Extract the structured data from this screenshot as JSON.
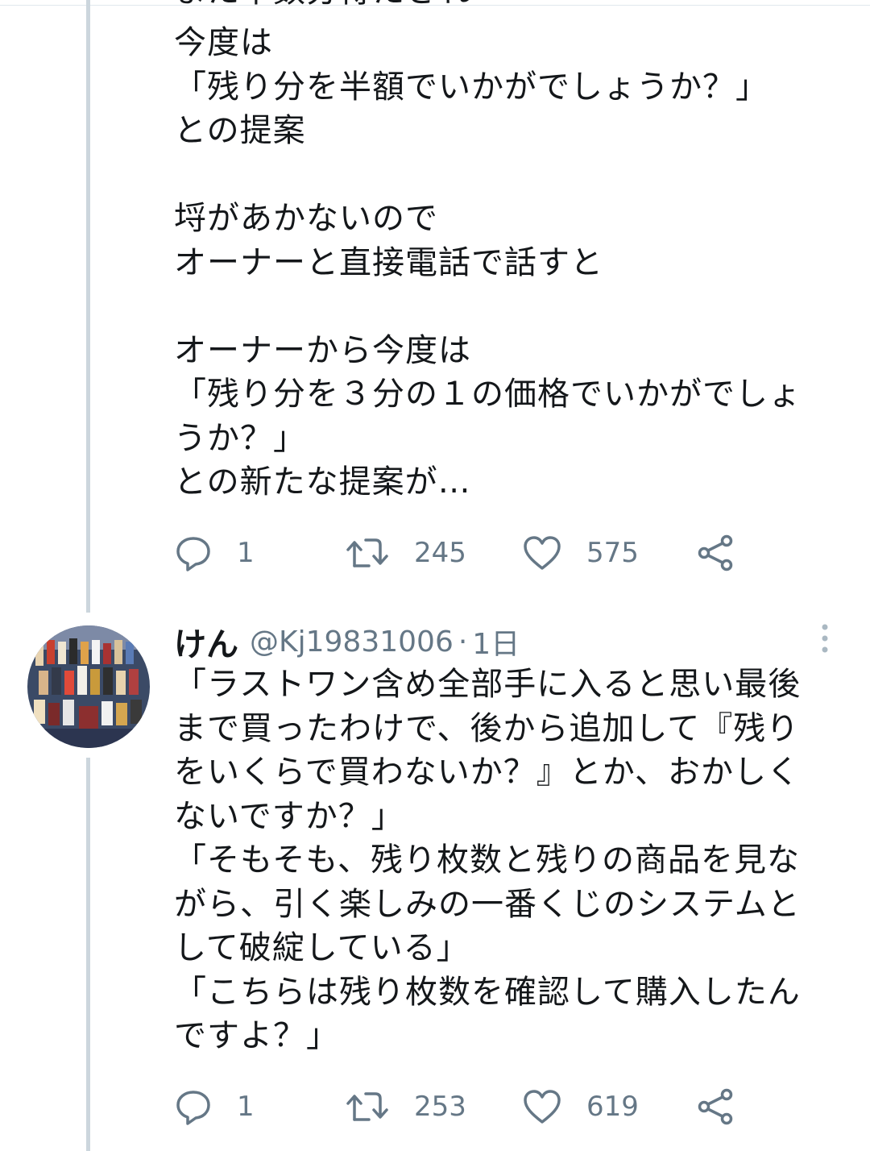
{
  "tweet1": {
    "cut_off_line": "また半数分得たされ",
    "text": "今度は\n「残り分を半額でいかがでしょうか？」\nとの提案\n\n埒があかないので\nオーナーと直接電話で話すと\n\nオーナーから今度は\n「残り分を３分の１の価格でいかがでしょうか？」\nとの新たな提案が…",
    "reply_count": "1",
    "retweet_count": "245",
    "like_count": "575"
  },
  "tweet2": {
    "display_name": "けん",
    "handle": "@Kj19831006",
    "separator": "·",
    "time": "1日",
    "text": "「ラストワン含め全部手に入ると思い最後まで買ったわけで、後から追加して『残りをいくらで買わないか？』とか、おかしくないですか？」\n「そもそも、残り枚数と残りの商品を見ながら、引く楽しみの一番くじのシステムとして破綻している」\n「こちらは残り枚数を確認して購入したんですよ？」",
    "reply_count": "1",
    "retweet_count": "253",
    "like_count": "619"
  },
  "icons": {
    "reply": "reply-icon",
    "retweet": "retweet-icon",
    "like": "heart-icon",
    "share": "share-icon",
    "more": "more-vertical-icon"
  },
  "colors": {
    "text": "#14171a",
    "secondary": "#657786",
    "thread_line": "#ccd6dd"
  }
}
